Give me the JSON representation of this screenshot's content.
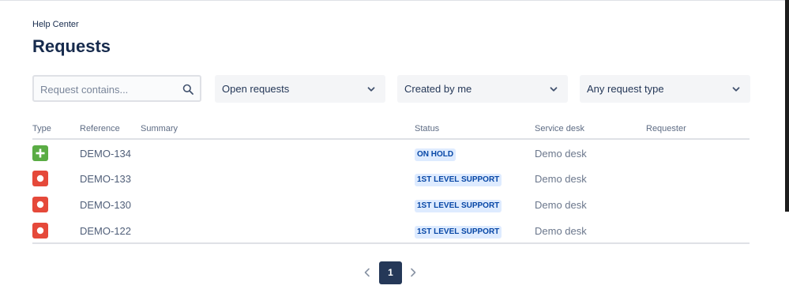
{
  "breadcrumb": "Help Center",
  "page_title": "Requests",
  "filters": {
    "search_placeholder": "Request contains...",
    "search_value": "",
    "status": "Open requests",
    "created_by": "Created by me",
    "request_type": "Any request type"
  },
  "table": {
    "columns": [
      "Type",
      "Reference",
      "Summary",
      "Status",
      "Service desk",
      "Requester"
    ],
    "rows": [
      {
        "type_icon": "plus-icon",
        "reference": "DEMO-134",
        "summary": "",
        "status": "ON HOLD",
        "service_desk": "Demo desk",
        "requester": ""
      },
      {
        "type_icon": "bug-icon",
        "reference": "DEMO-133",
        "summary": "",
        "status": "1ST LEVEL SUPPORT",
        "service_desk": "Demo desk",
        "requester": ""
      },
      {
        "type_icon": "bug-icon",
        "reference": "DEMO-130",
        "summary": "",
        "status": "1ST LEVEL SUPPORT",
        "service_desk": "Demo desk",
        "requester": ""
      },
      {
        "type_icon": "bug-icon",
        "reference": "DEMO-122",
        "summary": "",
        "status": "1ST LEVEL SUPPORT",
        "service_desk": "Demo desk",
        "requester": ""
      }
    ]
  },
  "pagination": {
    "current_page": "1",
    "prev_icon": "chevron-left-icon",
    "next_icon": "chevron-right-icon"
  },
  "colors": {
    "accent": "#253858",
    "status_bg": "#deebff",
    "status_text": "#0747a6",
    "new_feature": "#5aac44",
    "bug": "#e5493a"
  }
}
